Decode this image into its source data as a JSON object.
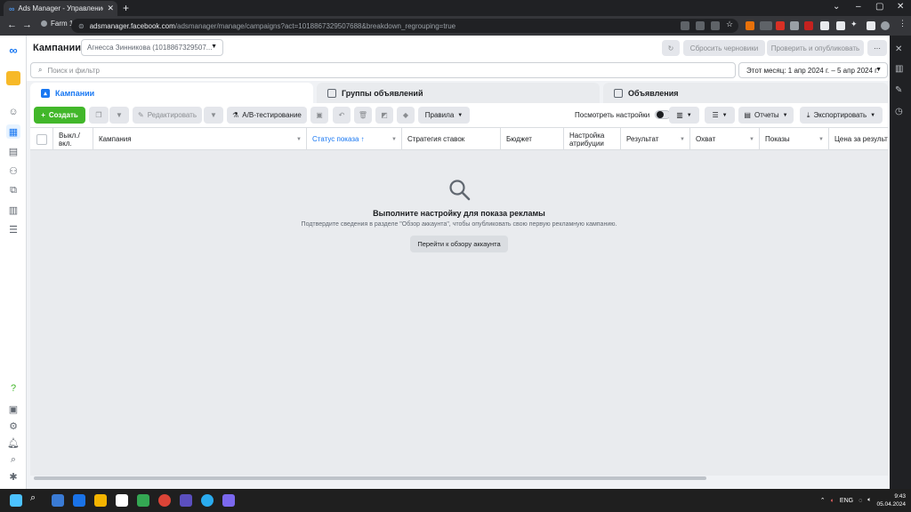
{
  "browser": {
    "tab_title": "Ads Manager - Управление рек",
    "tab_favicon": "∞",
    "new_tab": "+",
    "profile": "Farm 1",
    "url_host": "adsmanager.facebook.com",
    "url_path": "/adsmanager/manage/campaigns?act=1018867329507688&breakdown_regrouping=true"
  },
  "header": {
    "title": "Кампании",
    "account": "Агнесса Зинникова (1018867329507...",
    "discard_label": "Сбросить черновики",
    "publish_label": "Проверить и опубликовать",
    "more_label": "···"
  },
  "search": {
    "placeholder": "Поиск и фильтр",
    "date_range": "Этот месяц: 1 апр 2024 г. – 5 апр 2024 г."
  },
  "tabs": [
    {
      "label": "Кампании"
    },
    {
      "label": "Группы объявлений"
    },
    {
      "label": "Объявления"
    }
  ],
  "toolbar": {
    "create_label": "Создать",
    "edit_label": "Редактировать",
    "ab_label": "A/B-тестирование",
    "rules_label": "Правила",
    "view_settings_label": "Посмотреть настройки",
    "reports_label": "Отчеты",
    "export_label": "Экспортировать"
  },
  "table": {
    "columns": [
      "Выкл./ вкл.",
      "Кампания",
      "Статус показа",
      "Стратегия ставок",
      "Бюджет",
      "Настройка атрибуции",
      "Результат",
      "Охват",
      "Показы",
      "Цена за результ"
    ],
    "sorted_column_arrow": "↑"
  },
  "empty_state": {
    "title": "Выполните настройку для показа рекламы",
    "subtitle": "Подтвердите сведения в разделе \"Обзор аккаунта\", чтобы опубликовать свою первую рекламную кампанию.",
    "button_label": "Перейти к обзору аккаунта"
  },
  "taskbar": {
    "language": "ENG",
    "time": "9:43",
    "date": "05.04.2024"
  },
  "colors": {
    "accent": "#1877f2",
    "create_button": "#42b72a"
  }
}
